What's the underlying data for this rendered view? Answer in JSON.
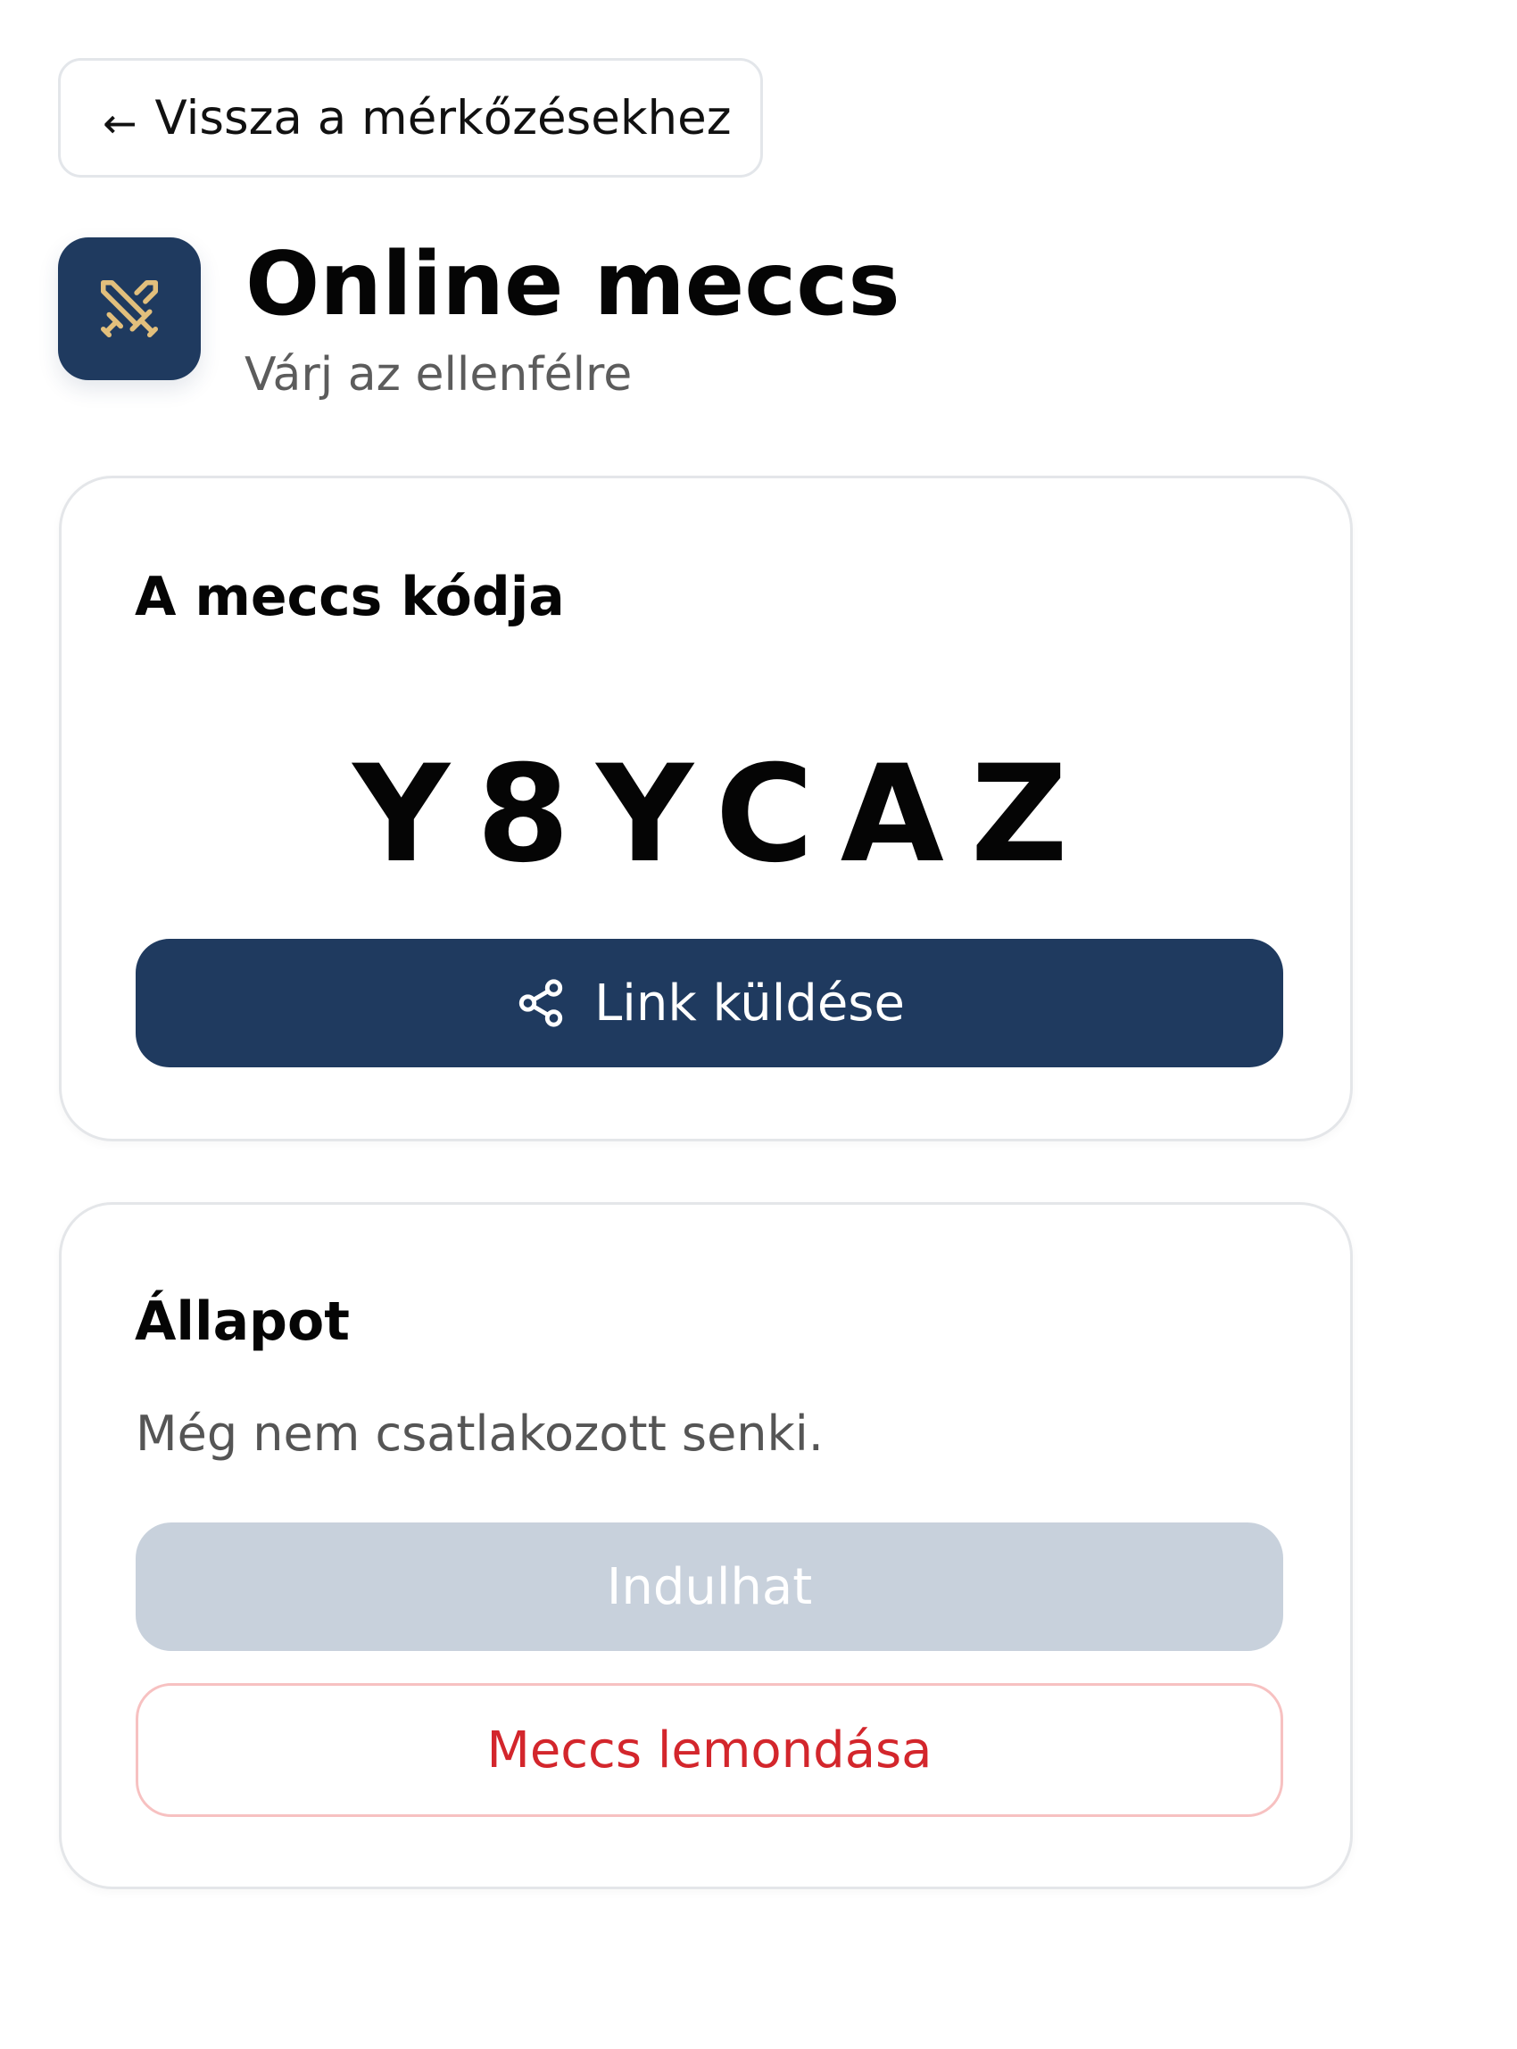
{
  "header": {
    "back_arrow": "←",
    "back_label": "Vissza a mérkőzésekhez",
    "icon": "crossed-swords-icon",
    "title": "Online meccs",
    "subtitle": "Várj az ellenfélre"
  },
  "code_card": {
    "heading": "A meccs kódja",
    "code": "Y8YCAZ",
    "share_icon": "share-icon",
    "share_label": "Link küldése"
  },
  "status_card": {
    "heading": "Állapot",
    "status_text": "Még nem csatlakozott senki.",
    "start_label": "Indulhat",
    "start_disabled": true,
    "cancel_label": "Meccs lemondása"
  },
  "colors": {
    "primary": "#1f3a5f",
    "icon_gold": "#e2bf7c",
    "disabled": "#c8d1dc",
    "danger": "#d3262c",
    "danger_border": "#f7c1c1"
  }
}
